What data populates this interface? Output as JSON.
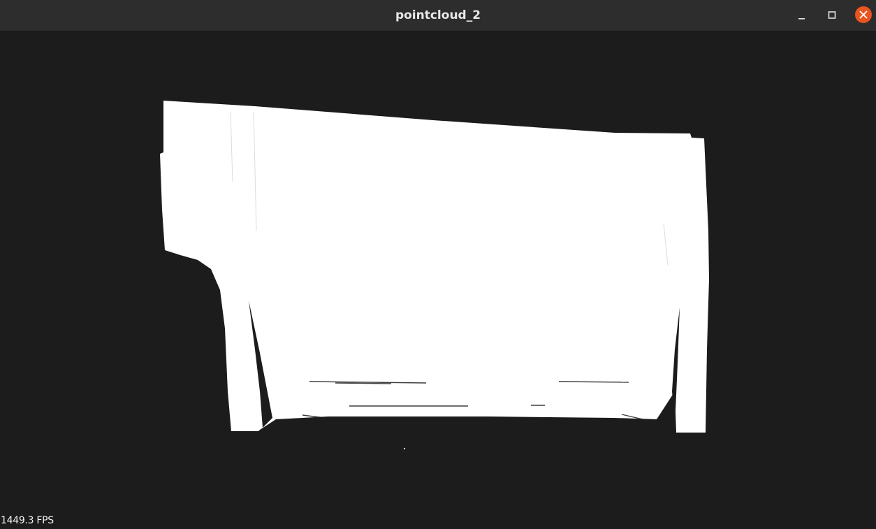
{
  "window": {
    "title": "pointcloud_2",
    "controls": {
      "minimize_icon": "minimize-icon",
      "maximize_icon": "maximize-icon",
      "close_icon": "close-icon",
      "close_color": "#e95420"
    }
  },
  "viewport": {
    "background_color": "#1c1c1c",
    "cloud_color": "#ffffff",
    "fps_label": "1449.3 FPS"
  }
}
